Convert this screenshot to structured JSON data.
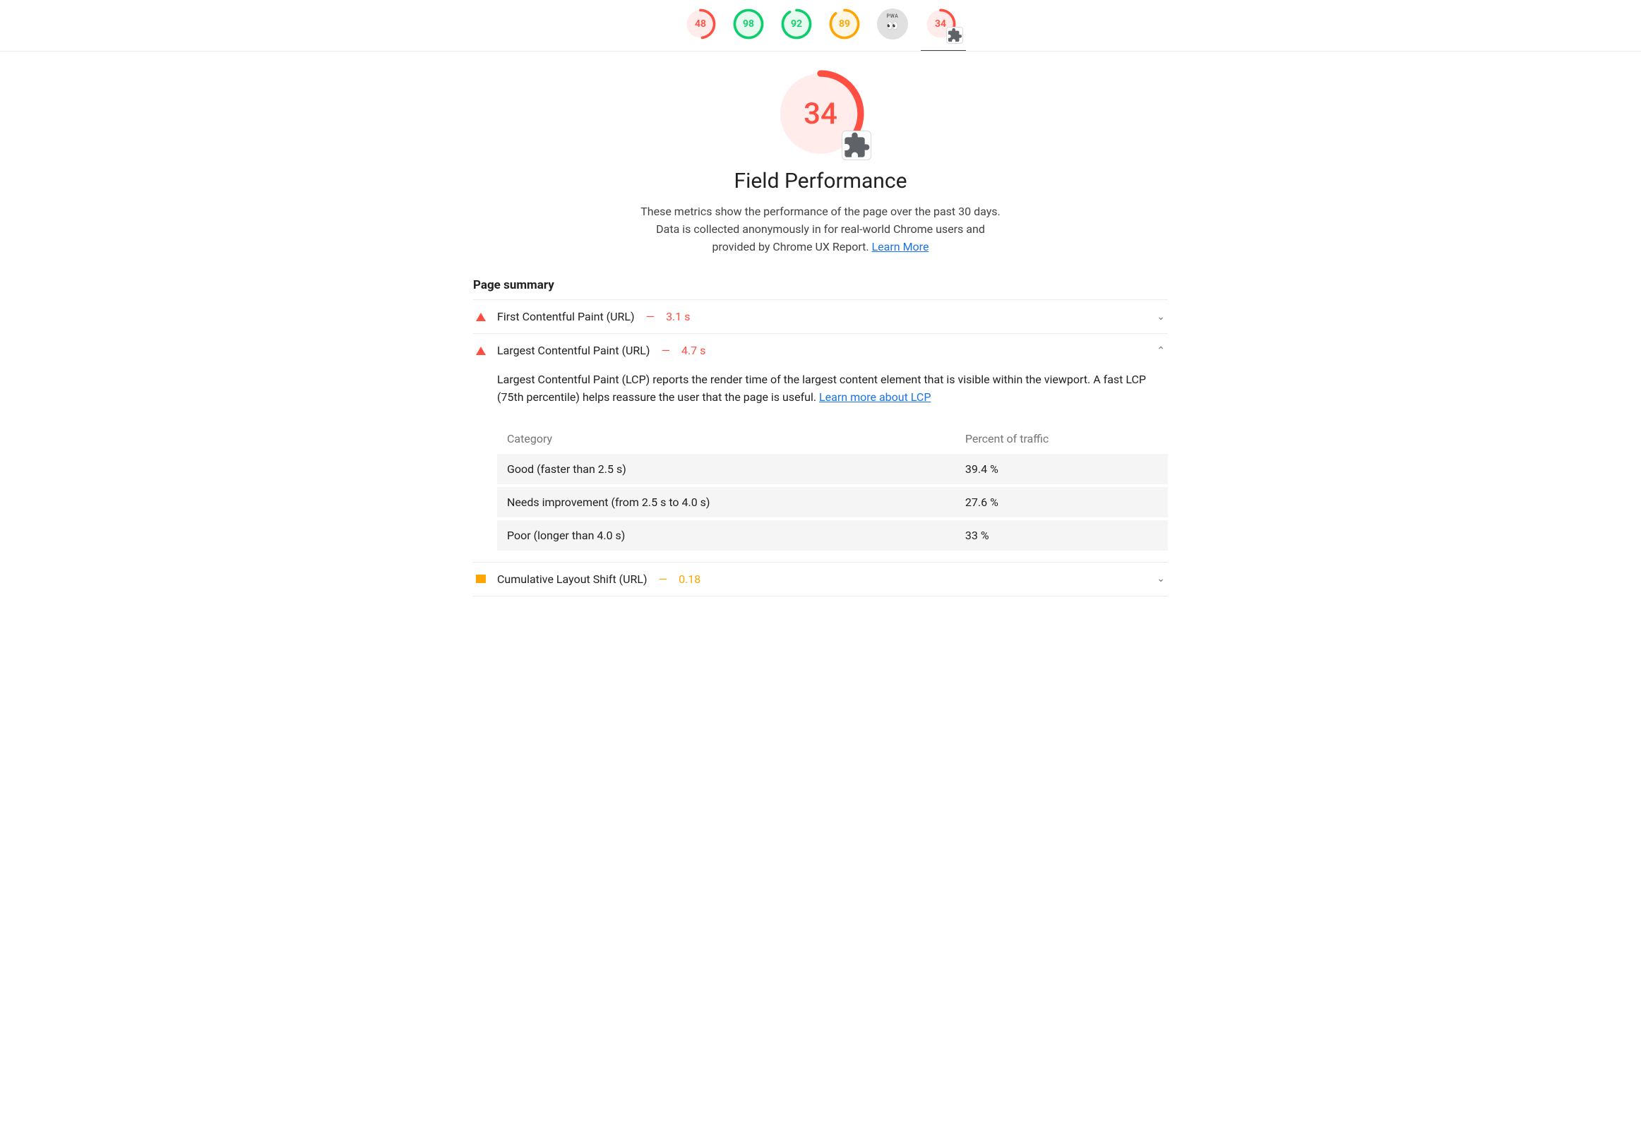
{
  "nav": {
    "scores": [
      {
        "value": "48",
        "color": "#ff4e42",
        "bg": "#ffeceb",
        "arc": 0.48,
        "selected": false,
        "icon": null
      },
      {
        "value": "98",
        "color": "#0cce6b",
        "bg": "#e6faef",
        "arc": 0.98,
        "selected": false,
        "icon": null
      },
      {
        "value": "92",
        "color": "#0cce6b",
        "bg": "#e6faef",
        "arc": 0.92,
        "selected": false,
        "icon": null
      },
      {
        "value": "89",
        "color": "#ffa400",
        "bg": "#fff7e5",
        "arc": 0.89,
        "selected": false,
        "icon": null
      },
      {
        "value": "",
        "color": "",
        "bg": "#e0e0e0",
        "arc": 0,
        "selected": false,
        "icon": "pwa"
      },
      {
        "value": "34",
        "color": "#ff4e42",
        "bg": "#ffeceb",
        "arc": 0.34,
        "selected": true,
        "icon": "ext"
      }
    ]
  },
  "hero": {
    "score": "34",
    "score_color": "#ff4e42",
    "score_bg": "#ffeceb",
    "score_arc": 0.34,
    "title": "Field Performance",
    "desc_before_link": "These metrics show the performance of the page over the past 30 days. Data is collected anonymously in for real-world Chrome users and provided by Chrome UX Report. ",
    "learn_more": "Learn More"
  },
  "summary": {
    "heading": "Page summary",
    "metrics": [
      {
        "icon": "tri-red",
        "label": "First Contentful Paint (URL)",
        "dash": "—",
        "value": "3.1 s",
        "value_class": "red",
        "expanded": false
      },
      {
        "icon": "tri-red",
        "label": "Largest Contentful Paint (URL)",
        "dash": "—",
        "value": "4.7 s",
        "value_class": "red",
        "expanded": true,
        "desc_before_link": "Largest Contentful Paint (LCP) reports the render time of the largest content element that is visible within the viewport. A fast LCP (75th percentile) helps reassure the user that the page is useful. ",
        "learn_more": "Learn more about LCP",
        "table": {
          "head_cat": "Category",
          "head_pct": "Percent of traffic",
          "rows": [
            {
              "cat": "Good (faster than 2.5 s)",
              "pct": "39.4 %"
            },
            {
              "cat": "Needs improvement (from 2.5 s to 4.0 s)",
              "pct": "27.6 %"
            },
            {
              "cat": "Poor (longer than 4.0 s)",
              "pct": "33 %"
            }
          ]
        }
      },
      {
        "icon": "sq-orange",
        "label": "Cumulative Layout Shift (URL)",
        "dash": "—",
        "value": "0.18",
        "value_class": "orange",
        "expanded": false
      }
    ]
  },
  "chart_data": {
    "type": "table",
    "title": "Largest Contentful Paint (URL) — traffic distribution",
    "columns": [
      "Category",
      "Percent of traffic"
    ],
    "rows": [
      [
        "Good (faster than 2.5 s)",
        39.4
      ],
      [
        "Needs improvement (from 2.5 s to 4.0 s)",
        27.6
      ],
      [
        "Poor (longer than 4.0 s)",
        33
      ]
    ],
    "unit": "%"
  }
}
